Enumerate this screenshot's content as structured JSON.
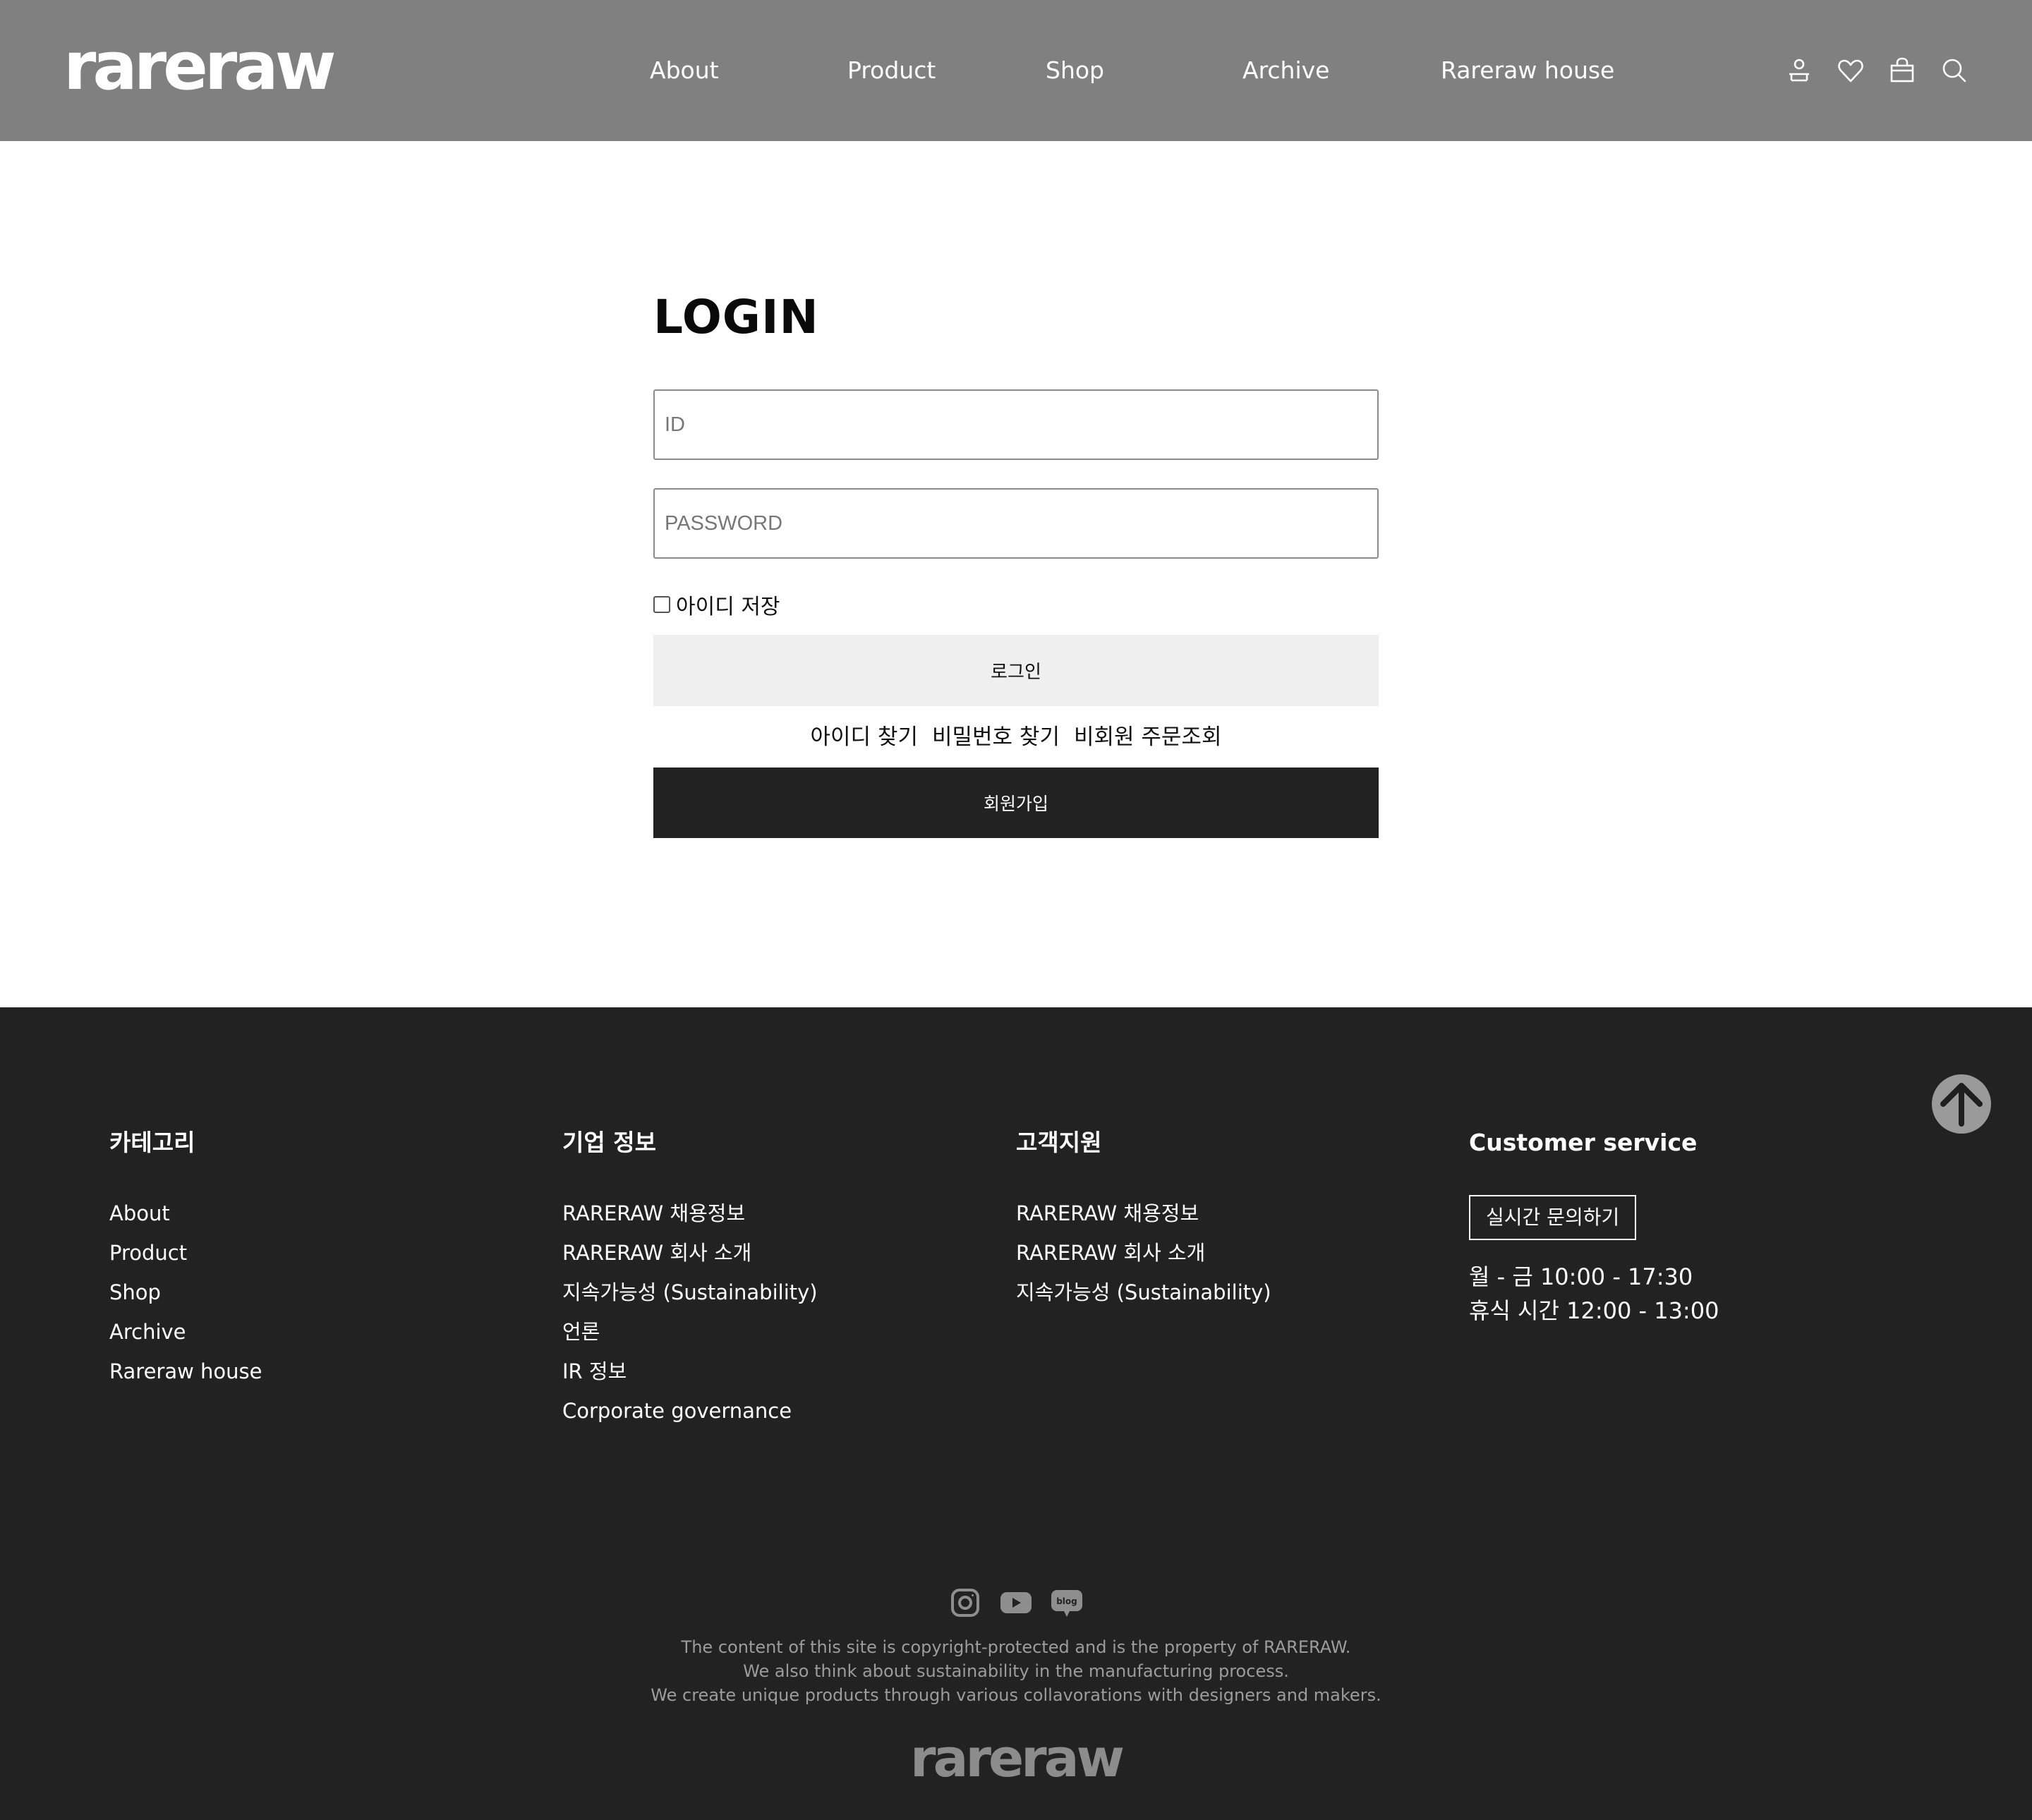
{
  "header": {
    "logo": "rareraw",
    "nav": [
      "About",
      "Product",
      "Shop",
      "Archive",
      "Rareraw house"
    ],
    "icons": [
      "user-icon",
      "heart-icon",
      "bag-icon",
      "search-icon"
    ]
  },
  "login": {
    "title": "LOGIN",
    "id_placeholder": "ID",
    "password_placeholder": "PASSWORD",
    "remember_label": "아이디 저장",
    "remember_checked": false,
    "login_button": "로그인",
    "find_id": "아이디 찾기",
    "find_password": "비밀번호 찾기",
    "guest_order": "비회원 주문조회",
    "join_button": "회원가입"
  },
  "footer": {
    "columns": [
      {
        "title": "카테고리",
        "items": [
          "About",
          "Product",
          "Shop",
          "Archive",
          "Rareraw house"
        ]
      },
      {
        "title": "기업 정보",
        "items": [
          "RARERAW 채용정보",
          "RARERAW 회사 소개",
          "지속가능성 (Sustainability)",
          "언론",
          "IR 정보",
          "Corporate governance"
        ]
      },
      {
        "title": "고객지원",
        "items": [
          "RARERAW 채용정보",
          "RARERAW 회사 소개",
          "지속가능성 (Sustainability)"
        ]
      }
    ],
    "customer_service": {
      "title": "Customer service",
      "chat_button": "실시간 문의하기",
      "hours_line1": "월  -  금 10:00  -  17:30",
      "hours_line2": "휴식 시간 12:00  -  13:00"
    },
    "social_icons": [
      "instagram-icon",
      "youtube-icon",
      "blog-icon"
    ],
    "blog_icon_text": "blog",
    "copyright": [
      "The content of this site is copyright-protected and is the property of RARERAW.",
      "We also think about sustainability in the manufacturing process.",
      "We create unique products through various collavorations with designers and makers."
    ],
    "logo": "rareraw"
  }
}
